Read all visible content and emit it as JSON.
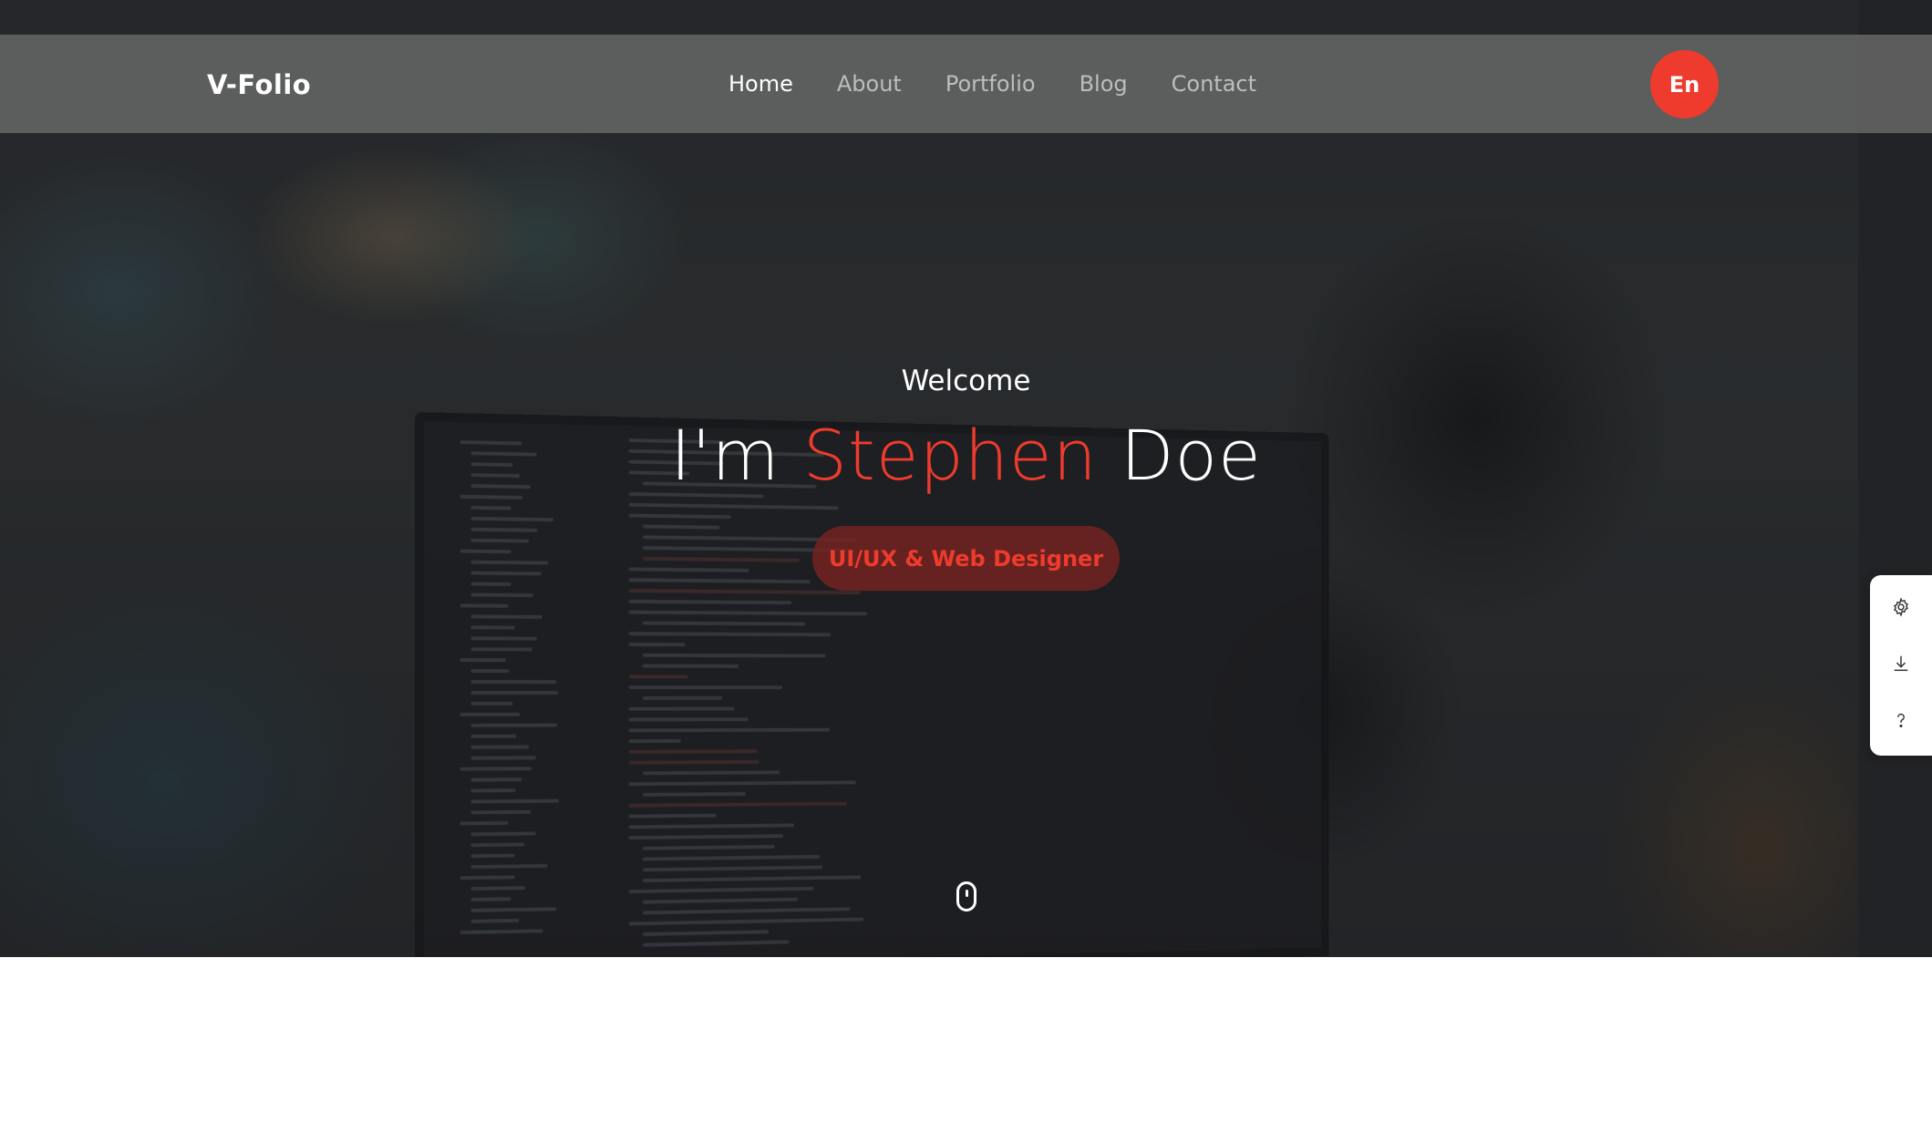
{
  "brand": {
    "name": "V-Folio"
  },
  "nav": {
    "items": [
      {
        "label": "Home",
        "active": true
      },
      {
        "label": "About",
        "active": false
      },
      {
        "label": "Portfolio",
        "active": false
      },
      {
        "label": "Blog",
        "active": false
      },
      {
        "label": "Contact",
        "active": false
      }
    ]
  },
  "language_button": {
    "label": "En"
  },
  "hero": {
    "welcome": "Welcome",
    "headline_prefix": "I'm",
    "headline_accent": "Stephen",
    "headline_suffix": "Doe",
    "role": "UI/UX & Web Designer"
  },
  "side_panel": {
    "icons": [
      "gear-icon",
      "download-icon",
      "help-icon"
    ]
  },
  "colors": {
    "accent": "#ef3b2d",
    "nav_bg": "#696969",
    "role_badge_bg": "#732320"
  }
}
